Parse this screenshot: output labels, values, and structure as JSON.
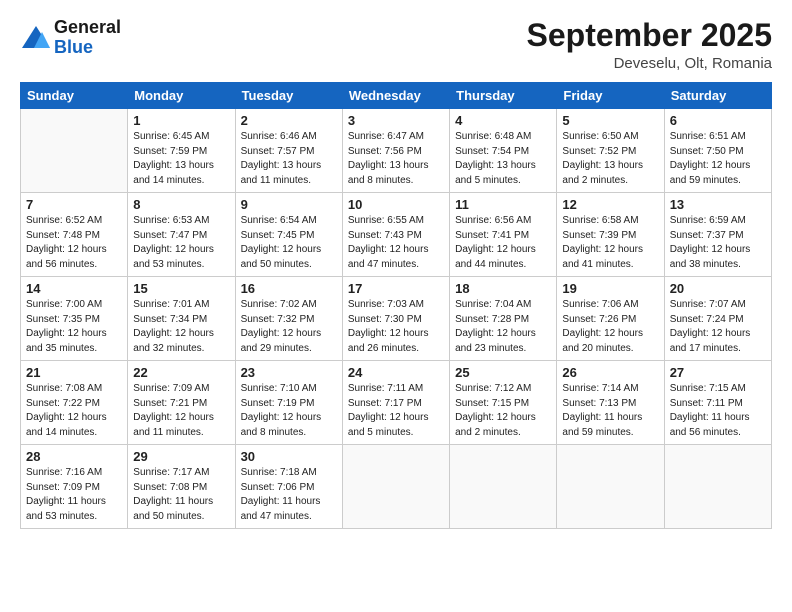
{
  "header": {
    "logo_line1": "General",
    "logo_line2": "Blue",
    "month": "September 2025",
    "location": "Deveselu, Olt, Romania"
  },
  "weekdays": [
    "Sunday",
    "Monday",
    "Tuesday",
    "Wednesday",
    "Thursday",
    "Friday",
    "Saturday"
  ],
  "weeks": [
    [
      {
        "day": "",
        "sunrise": "",
        "sunset": "",
        "daylight": ""
      },
      {
        "day": "1",
        "sunrise": "Sunrise: 6:45 AM",
        "sunset": "Sunset: 7:59 PM",
        "daylight": "Daylight: 13 hours and 14 minutes."
      },
      {
        "day": "2",
        "sunrise": "Sunrise: 6:46 AM",
        "sunset": "Sunset: 7:57 PM",
        "daylight": "Daylight: 13 hours and 11 minutes."
      },
      {
        "day": "3",
        "sunrise": "Sunrise: 6:47 AM",
        "sunset": "Sunset: 7:56 PM",
        "daylight": "Daylight: 13 hours and 8 minutes."
      },
      {
        "day": "4",
        "sunrise": "Sunrise: 6:48 AM",
        "sunset": "Sunset: 7:54 PM",
        "daylight": "Daylight: 13 hours and 5 minutes."
      },
      {
        "day": "5",
        "sunrise": "Sunrise: 6:50 AM",
        "sunset": "Sunset: 7:52 PM",
        "daylight": "Daylight: 13 hours and 2 minutes."
      },
      {
        "day": "6",
        "sunrise": "Sunrise: 6:51 AM",
        "sunset": "Sunset: 7:50 PM",
        "daylight": "Daylight: 12 hours and 59 minutes."
      }
    ],
    [
      {
        "day": "7",
        "sunrise": "Sunrise: 6:52 AM",
        "sunset": "Sunset: 7:48 PM",
        "daylight": "Daylight: 12 hours and 56 minutes."
      },
      {
        "day": "8",
        "sunrise": "Sunrise: 6:53 AM",
        "sunset": "Sunset: 7:47 PM",
        "daylight": "Daylight: 12 hours and 53 minutes."
      },
      {
        "day": "9",
        "sunrise": "Sunrise: 6:54 AM",
        "sunset": "Sunset: 7:45 PM",
        "daylight": "Daylight: 12 hours and 50 minutes."
      },
      {
        "day": "10",
        "sunrise": "Sunrise: 6:55 AM",
        "sunset": "Sunset: 7:43 PM",
        "daylight": "Daylight: 12 hours and 47 minutes."
      },
      {
        "day": "11",
        "sunrise": "Sunrise: 6:56 AM",
        "sunset": "Sunset: 7:41 PM",
        "daylight": "Daylight: 12 hours and 44 minutes."
      },
      {
        "day": "12",
        "sunrise": "Sunrise: 6:58 AM",
        "sunset": "Sunset: 7:39 PM",
        "daylight": "Daylight: 12 hours and 41 minutes."
      },
      {
        "day": "13",
        "sunrise": "Sunrise: 6:59 AM",
        "sunset": "Sunset: 7:37 PM",
        "daylight": "Daylight: 12 hours and 38 minutes."
      }
    ],
    [
      {
        "day": "14",
        "sunrise": "Sunrise: 7:00 AM",
        "sunset": "Sunset: 7:35 PM",
        "daylight": "Daylight: 12 hours and 35 minutes."
      },
      {
        "day": "15",
        "sunrise": "Sunrise: 7:01 AM",
        "sunset": "Sunset: 7:34 PM",
        "daylight": "Daylight: 12 hours and 32 minutes."
      },
      {
        "day": "16",
        "sunrise": "Sunrise: 7:02 AM",
        "sunset": "Sunset: 7:32 PM",
        "daylight": "Daylight: 12 hours and 29 minutes."
      },
      {
        "day": "17",
        "sunrise": "Sunrise: 7:03 AM",
        "sunset": "Sunset: 7:30 PM",
        "daylight": "Daylight: 12 hours and 26 minutes."
      },
      {
        "day": "18",
        "sunrise": "Sunrise: 7:04 AM",
        "sunset": "Sunset: 7:28 PM",
        "daylight": "Daylight: 12 hours and 23 minutes."
      },
      {
        "day": "19",
        "sunrise": "Sunrise: 7:06 AM",
        "sunset": "Sunset: 7:26 PM",
        "daylight": "Daylight: 12 hours and 20 minutes."
      },
      {
        "day": "20",
        "sunrise": "Sunrise: 7:07 AM",
        "sunset": "Sunset: 7:24 PM",
        "daylight": "Daylight: 12 hours and 17 minutes."
      }
    ],
    [
      {
        "day": "21",
        "sunrise": "Sunrise: 7:08 AM",
        "sunset": "Sunset: 7:22 PM",
        "daylight": "Daylight: 12 hours and 14 minutes."
      },
      {
        "day": "22",
        "sunrise": "Sunrise: 7:09 AM",
        "sunset": "Sunset: 7:21 PM",
        "daylight": "Daylight: 12 hours and 11 minutes."
      },
      {
        "day": "23",
        "sunrise": "Sunrise: 7:10 AM",
        "sunset": "Sunset: 7:19 PM",
        "daylight": "Daylight: 12 hours and 8 minutes."
      },
      {
        "day": "24",
        "sunrise": "Sunrise: 7:11 AM",
        "sunset": "Sunset: 7:17 PM",
        "daylight": "Daylight: 12 hours and 5 minutes."
      },
      {
        "day": "25",
        "sunrise": "Sunrise: 7:12 AM",
        "sunset": "Sunset: 7:15 PM",
        "daylight": "Daylight: 12 hours and 2 minutes."
      },
      {
        "day": "26",
        "sunrise": "Sunrise: 7:14 AM",
        "sunset": "Sunset: 7:13 PM",
        "daylight": "Daylight: 11 hours and 59 minutes."
      },
      {
        "day": "27",
        "sunrise": "Sunrise: 7:15 AM",
        "sunset": "Sunset: 7:11 PM",
        "daylight": "Daylight: 11 hours and 56 minutes."
      }
    ],
    [
      {
        "day": "28",
        "sunrise": "Sunrise: 7:16 AM",
        "sunset": "Sunset: 7:09 PM",
        "daylight": "Daylight: 11 hours and 53 minutes."
      },
      {
        "day": "29",
        "sunrise": "Sunrise: 7:17 AM",
        "sunset": "Sunset: 7:08 PM",
        "daylight": "Daylight: 11 hours and 50 minutes."
      },
      {
        "day": "30",
        "sunrise": "Sunrise: 7:18 AM",
        "sunset": "Sunset: 7:06 PM",
        "daylight": "Daylight: 11 hours and 47 minutes."
      },
      {
        "day": "",
        "sunrise": "",
        "sunset": "",
        "daylight": ""
      },
      {
        "day": "",
        "sunrise": "",
        "sunset": "",
        "daylight": ""
      },
      {
        "day": "",
        "sunrise": "",
        "sunset": "",
        "daylight": ""
      },
      {
        "day": "",
        "sunrise": "",
        "sunset": "",
        "daylight": ""
      }
    ]
  ]
}
